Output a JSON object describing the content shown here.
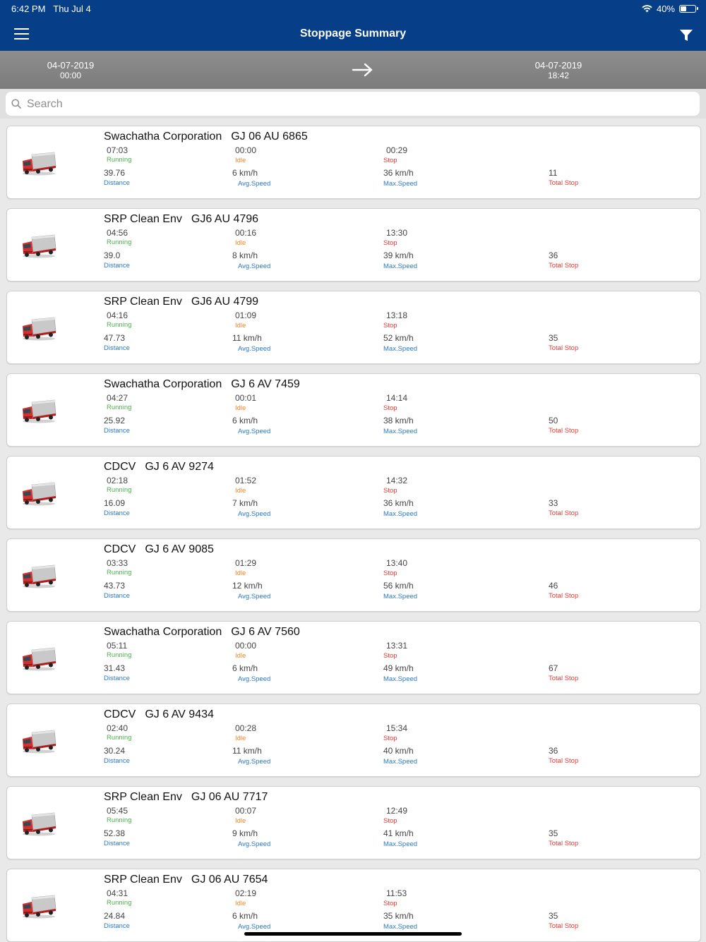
{
  "status_bar": {
    "time": "6:42 PM",
    "date": "Thu Jul 4",
    "battery": "40%",
    "battery_level": 0.4
  },
  "header": {
    "title": "Stoppage Summary"
  },
  "date_range": {
    "from_date": "04-07-2019",
    "from_time": "00:00",
    "to_date": "04-07-2019",
    "to_time": "18:42"
  },
  "search": {
    "placeholder": "Search"
  },
  "labels": {
    "running": "Running",
    "idle": "Idle",
    "stop": "Stop",
    "distance": "Distance",
    "avg_speed": "Avg.Speed",
    "max_speed": "Max.Speed",
    "total_stop": "Total Stop"
  },
  "colors": {
    "header": "#063e87",
    "running": "#4caf50",
    "idle": "#f0872a",
    "stop": "#e53935",
    "label_blue": "#2b79c5"
  },
  "vehicles": [
    {
      "name": "Swachatha Corporation",
      "plate": "GJ 06 AU 6865",
      "running": "07:03",
      "idle": "00:00",
      "stop": "00:29",
      "distance": "39.76",
      "avg_speed": "6 km/h",
      "max_speed": "36 km/h",
      "total_stop": "11"
    },
    {
      "name": "SRP Clean Env",
      "plate": "GJ6 AU 4796",
      "running": "04:56",
      "idle": "00:16",
      "stop": "13:30",
      "distance": "39.0",
      "avg_speed": "8 km/h",
      "max_speed": "39 km/h",
      "total_stop": "36"
    },
    {
      "name": "SRP Clean Env",
      "plate": "GJ6 AU 4799",
      "running": "04:16",
      "idle": "01:09",
      "stop": "13:18",
      "distance": "47.73",
      "avg_speed": "11 km/h",
      "max_speed": "52 km/h",
      "total_stop": "35"
    },
    {
      "name": "Swachatha Corporation",
      "plate": "GJ 6 AV 7459",
      "running": "04:27",
      "idle": "00:01",
      "stop": "14:14",
      "distance": "25.92",
      "avg_speed": "6 km/h",
      "max_speed": "38 km/h",
      "total_stop": "50"
    },
    {
      "name": "CDCV",
      "plate": "GJ 6 AV 9274",
      "running": "02:18",
      "idle": "01:52",
      "stop": "14:32",
      "distance": "16.09",
      "avg_speed": "7 km/h",
      "max_speed": "36 km/h",
      "total_stop": "33"
    },
    {
      "name": "CDCV",
      "plate": "GJ 6 AV 9085",
      "running": "03:33",
      "idle": "01:29",
      "stop": "13:40",
      "distance": "43.73",
      "avg_speed": "12 km/h",
      "max_speed": "56 km/h",
      "total_stop": "46"
    },
    {
      "name": "Swachatha Corporation",
      "plate": "GJ 6 AV 7560",
      "running": "05:11",
      "idle": "00:00",
      "stop": "13:31",
      "distance": "31.43",
      "avg_speed": "6 km/h",
      "max_speed": "49 km/h",
      "total_stop": "67"
    },
    {
      "name": "CDCV",
      "plate": "GJ 6 AV 9434",
      "running": "02:40",
      "idle": "00:28",
      "stop": "15:34",
      "distance": "30.24",
      "avg_speed": "11 km/h",
      "max_speed": "40 km/h",
      "total_stop": "36"
    },
    {
      "name": "SRP Clean Env",
      "plate": "GJ 06 AU 7717",
      "running": "05:45",
      "idle": "00:07",
      "stop": "12:49",
      "distance": "52.38",
      "avg_speed": "9 km/h",
      "max_speed": "41 km/h",
      "total_stop": "35"
    },
    {
      "name": "SRP Clean Env",
      "plate": "GJ 06 AU 7654",
      "running": "04:31",
      "idle": "02:19",
      "stop": "11:53",
      "distance": "24.84",
      "avg_speed": "6 km/h",
      "max_speed": "35 km/h",
      "total_stop": "35"
    }
  ]
}
